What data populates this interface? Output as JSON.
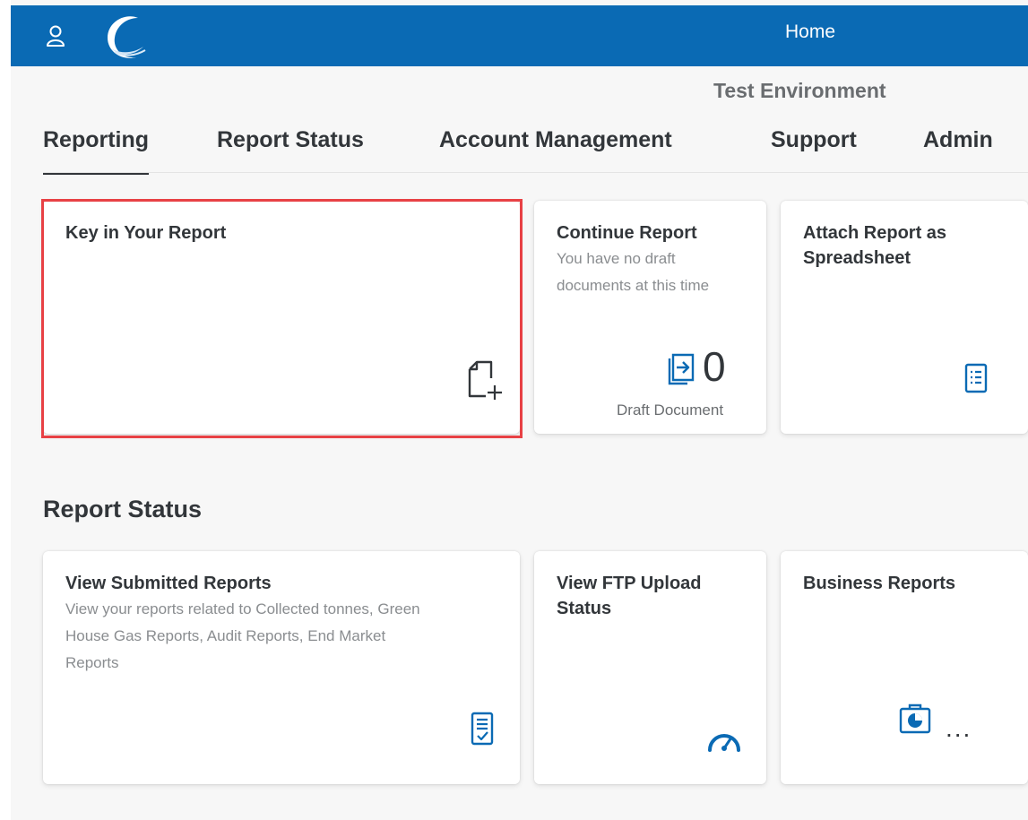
{
  "header": {
    "title": "Home",
    "environment": "Test Environment"
  },
  "tabs": [
    {
      "label": "Reporting",
      "active": true
    },
    {
      "label": "Report Status",
      "active": false
    },
    {
      "label": "Account Management",
      "active": false
    },
    {
      "label": "Support",
      "active": false
    },
    {
      "label": "Admin",
      "active": false
    }
  ],
  "reporting_tiles": {
    "key_in": {
      "title": "Key in Your Report",
      "icon": "new-document-icon",
      "highlighted": true
    },
    "continue": {
      "title": "Continue Report",
      "subtitle_line1": "You have no draft",
      "subtitle_line2": "documents at this time",
      "kpi_value": "0",
      "kpi_label": "Draft Document",
      "icon": "open-document-icon"
    },
    "attach": {
      "title_line1": "Attach Report as",
      "title_line2": "Spreadsheet",
      "icon": "spreadsheet-icon"
    }
  },
  "report_status": {
    "heading": "Report Status",
    "view_submitted": {
      "title": "View Submitted Reports",
      "subtitle_line1": "View your reports related to Collected tonnes, Green",
      "subtitle_line2": "House Gas Reports, Audit Reports, End Market",
      "subtitle_line3": "Reports",
      "icon": "checked-document-icon"
    },
    "ftp": {
      "title_line1": "View FTP Upload",
      "title_line2": "Status",
      "icon": "speedometer-icon"
    },
    "business": {
      "title": "Business Reports",
      "icon": "business-report-icon",
      "more": "..."
    }
  },
  "colors": {
    "brand": "#0a6ab4",
    "highlight": "#e84145",
    "icon": "#0a6ab4"
  }
}
